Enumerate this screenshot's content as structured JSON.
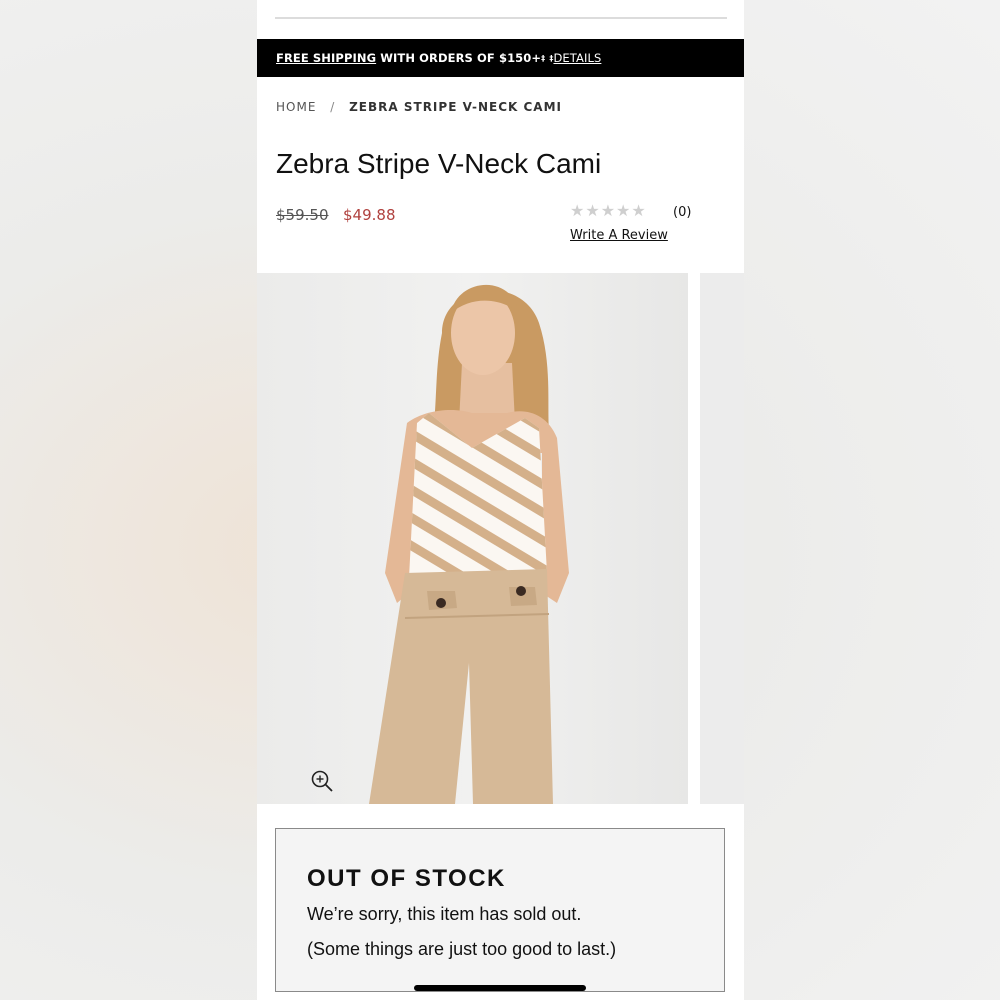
{
  "promo": {
    "free_shipping": "FREE SHIPPING",
    "middle": " WITH ORDERS OF $150+",
    "mark1": "‡",
    "mark2": "‡",
    "details": "DETAILS"
  },
  "breadcrumb": {
    "home": "HOME",
    "separator": "/",
    "current": "ZEBRA STRIPE V-NECK CAMI"
  },
  "product": {
    "title": "Zebra Stripe V-Neck Cami",
    "price_original": "$59.50",
    "price_sale": "$49.88",
    "rating_stars": "★★★★★",
    "review_count": "(0)",
    "write_review": "Write A Review"
  },
  "gallery": {
    "zoom_icon": "zoom-in-icon"
  },
  "stock": {
    "title": "OUT OF STOCK",
    "line1": "We’re sorry, this item has sold out.",
    "line2": "(Some things are just too good to last.)"
  },
  "colors": {
    "sale_price": "#b0413e",
    "promo_bg": "#000000",
    "star_empty": "#cfcfcf",
    "camisole_stripe": "#d4b08a",
    "trousers": "#d6b997"
  }
}
